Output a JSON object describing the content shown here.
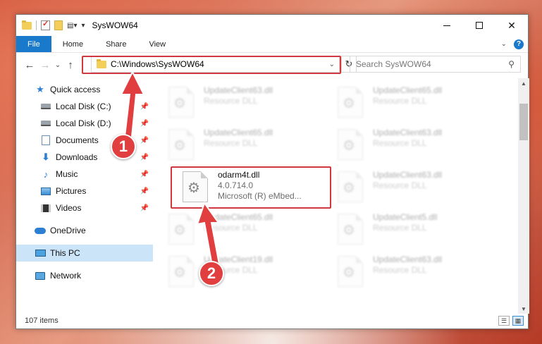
{
  "window": {
    "title": "SysWOW64",
    "controls": {
      "minimize": "minimize",
      "maximize": "maximize",
      "close": "✕"
    }
  },
  "ribbon": {
    "tabs": [
      {
        "label": "File"
      },
      {
        "label": "Home"
      },
      {
        "label": "Share"
      },
      {
        "label": "View"
      }
    ],
    "help": "?"
  },
  "navigation": {
    "address": "C:\\Windows\\SysWOW64",
    "search_placeholder": "Search SysWOW64"
  },
  "sidebar": {
    "items": [
      {
        "label": "Quick access",
        "icon": "star-icon"
      },
      {
        "label": "Local Disk (C:)",
        "icon": "disk-icon",
        "pinned": true
      },
      {
        "label": "Local Disk (D:)",
        "icon": "disk-icon",
        "pinned": true
      },
      {
        "label": "Documents",
        "icon": "documents-icon",
        "pinned": true
      },
      {
        "label": "Downloads",
        "icon": "downloads-icon",
        "pinned": true
      },
      {
        "label": "Music",
        "icon": "music-icon",
        "pinned": true
      },
      {
        "label": "Pictures",
        "icon": "pictures-icon",
        "pinned": true
      },
      {
        "label": "Videos",
        "icon": "videos-icon",
        "pinned": true
      },
      {
        "label": "OneDrive",
        "icon": "cloud-icon"
      },
      {
        "label": "This PC",
        "icon": "computer-icon",
        "selected": true
      },
      {
        "label": "Network",
        "icon": "network-icon"
      }
    ]
  },
  "files": [
    {
      "name": "UpdateClient63.dll",
      "sub1": "Resource DLL",
      "sub2": ""
    },
    {
      "name": "UpdateClient65.dll",
      "sub1": "Resource DLL",
      "sub2": ""
    },
    {
      "name": "UpdateClient65.dll",
      "sub1": "Resource DLL",
      "sub2": ""
    },
    {
      "name": "UpdateClient63.dll",
      "sub1": "Resource DLL",
      "sub2": ""
    },
    {
      "name": "odarm4t.dll",
      "sub1": "4.0.714.0",
      "sub2": "Microsoft (R) eMbed..."
    },
    {
      "name": "UpdateClient63.dll",
      "sub1": "Resource DLL",
      "sub2": ""
    },
    {
      "name": "UpdateClient65.dll",
      "sub1": "Resource DLL",
      "sub2": ""
    },
    {
      "name": "UpdateClient5.dll",
      "sub1": "Resource DLL",
      "sub2": ""
    },
    {
      "name": "UpdateClient19.dll",
      "sub1": "Resource DLL",
      "sub2": ""
    },
    {
      "name": "UpdateClient63.dll",
      "sub1": "Resource DLL",
      "sub2": ""
    }
  ],
  "status": {
    "items_count": "107 items"
  },
  "annotations": {
    "step1": "1",
    "step2": "2",
    "accent": "#e03e3f"
  }
}
